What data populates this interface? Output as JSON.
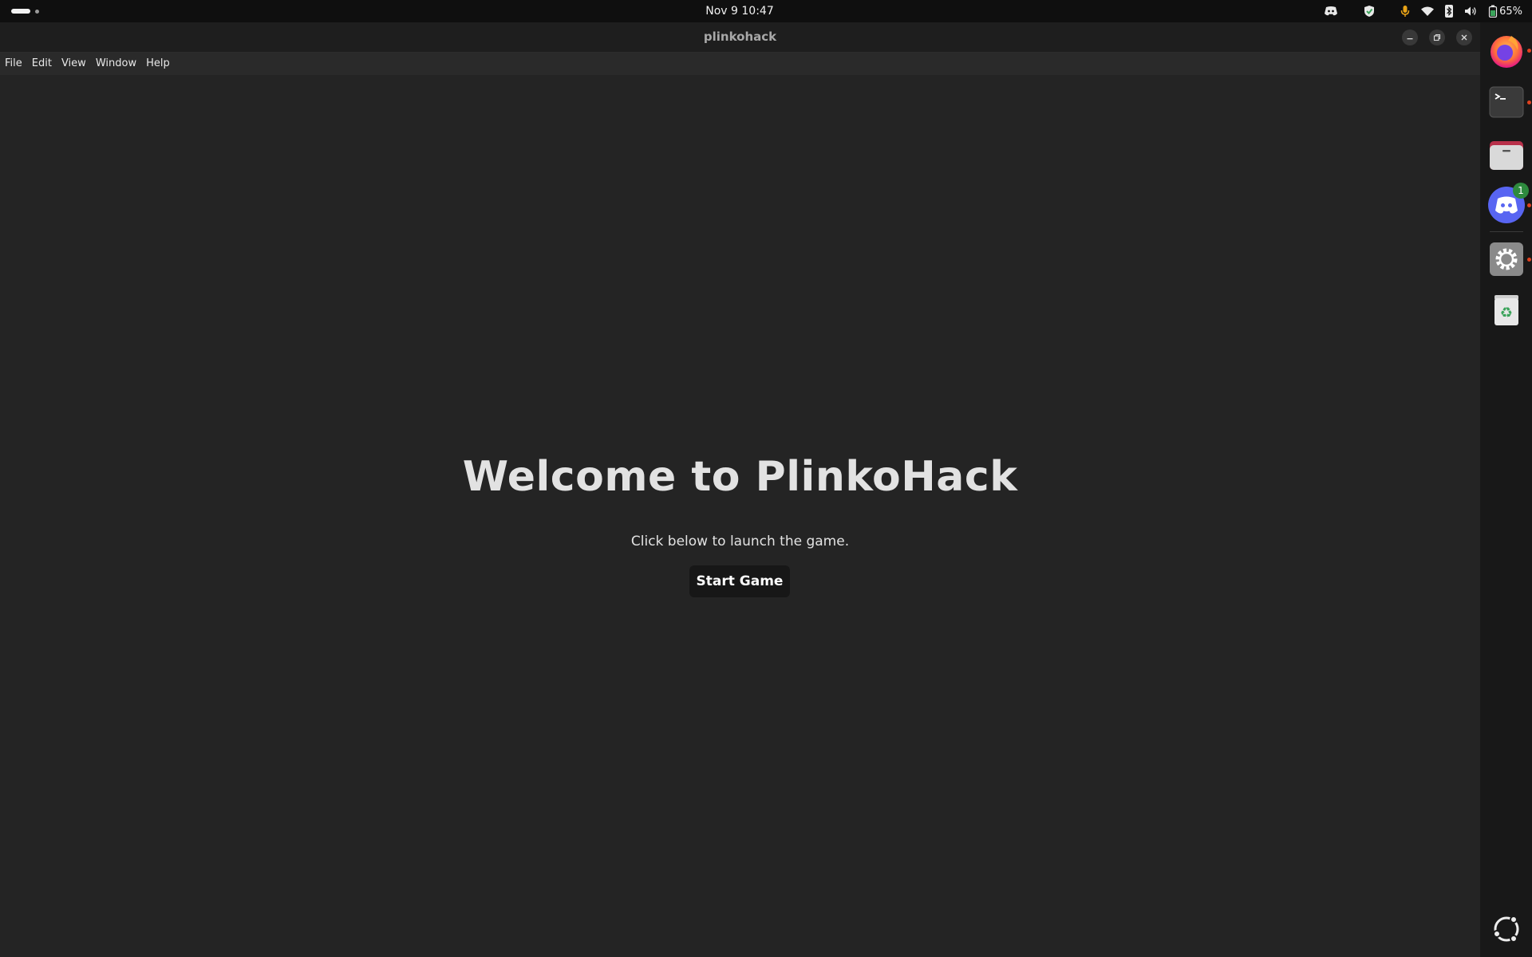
{
  "system_bar": {
    "clock": "Nov 9  10:47",
    "battery_percent": "65%"
  },
  "window": {
    "title": "plinkohack"
  },
  "menu": {
    "items": [
      "File",
      "Edit",
      "View",
      "Window",
      "Help"
    ]
  },
  "main": {
    "heading": "Welcome to PlinkoHack",
    "subtitle": "Click below to launch the game.",
    "start_button_label": "Start Game"
  },
  "dock": {
    "discord_badge": "1",
    "items": [
      "firefox-icon",
      "terminal-icon",
      "files-icon",
      "discord-icon",
      "settings-icon",
      "trash-icon",
      "ubuntu-apps-icon"
    ]
  },
  "colors": {
    "background": "#242424",
    "topbar": "#0f0f0f",
    "button": "#171717",
    "accent_orange": "#e0411e",
    "discord_blue": "#5865f2"
  }
}
